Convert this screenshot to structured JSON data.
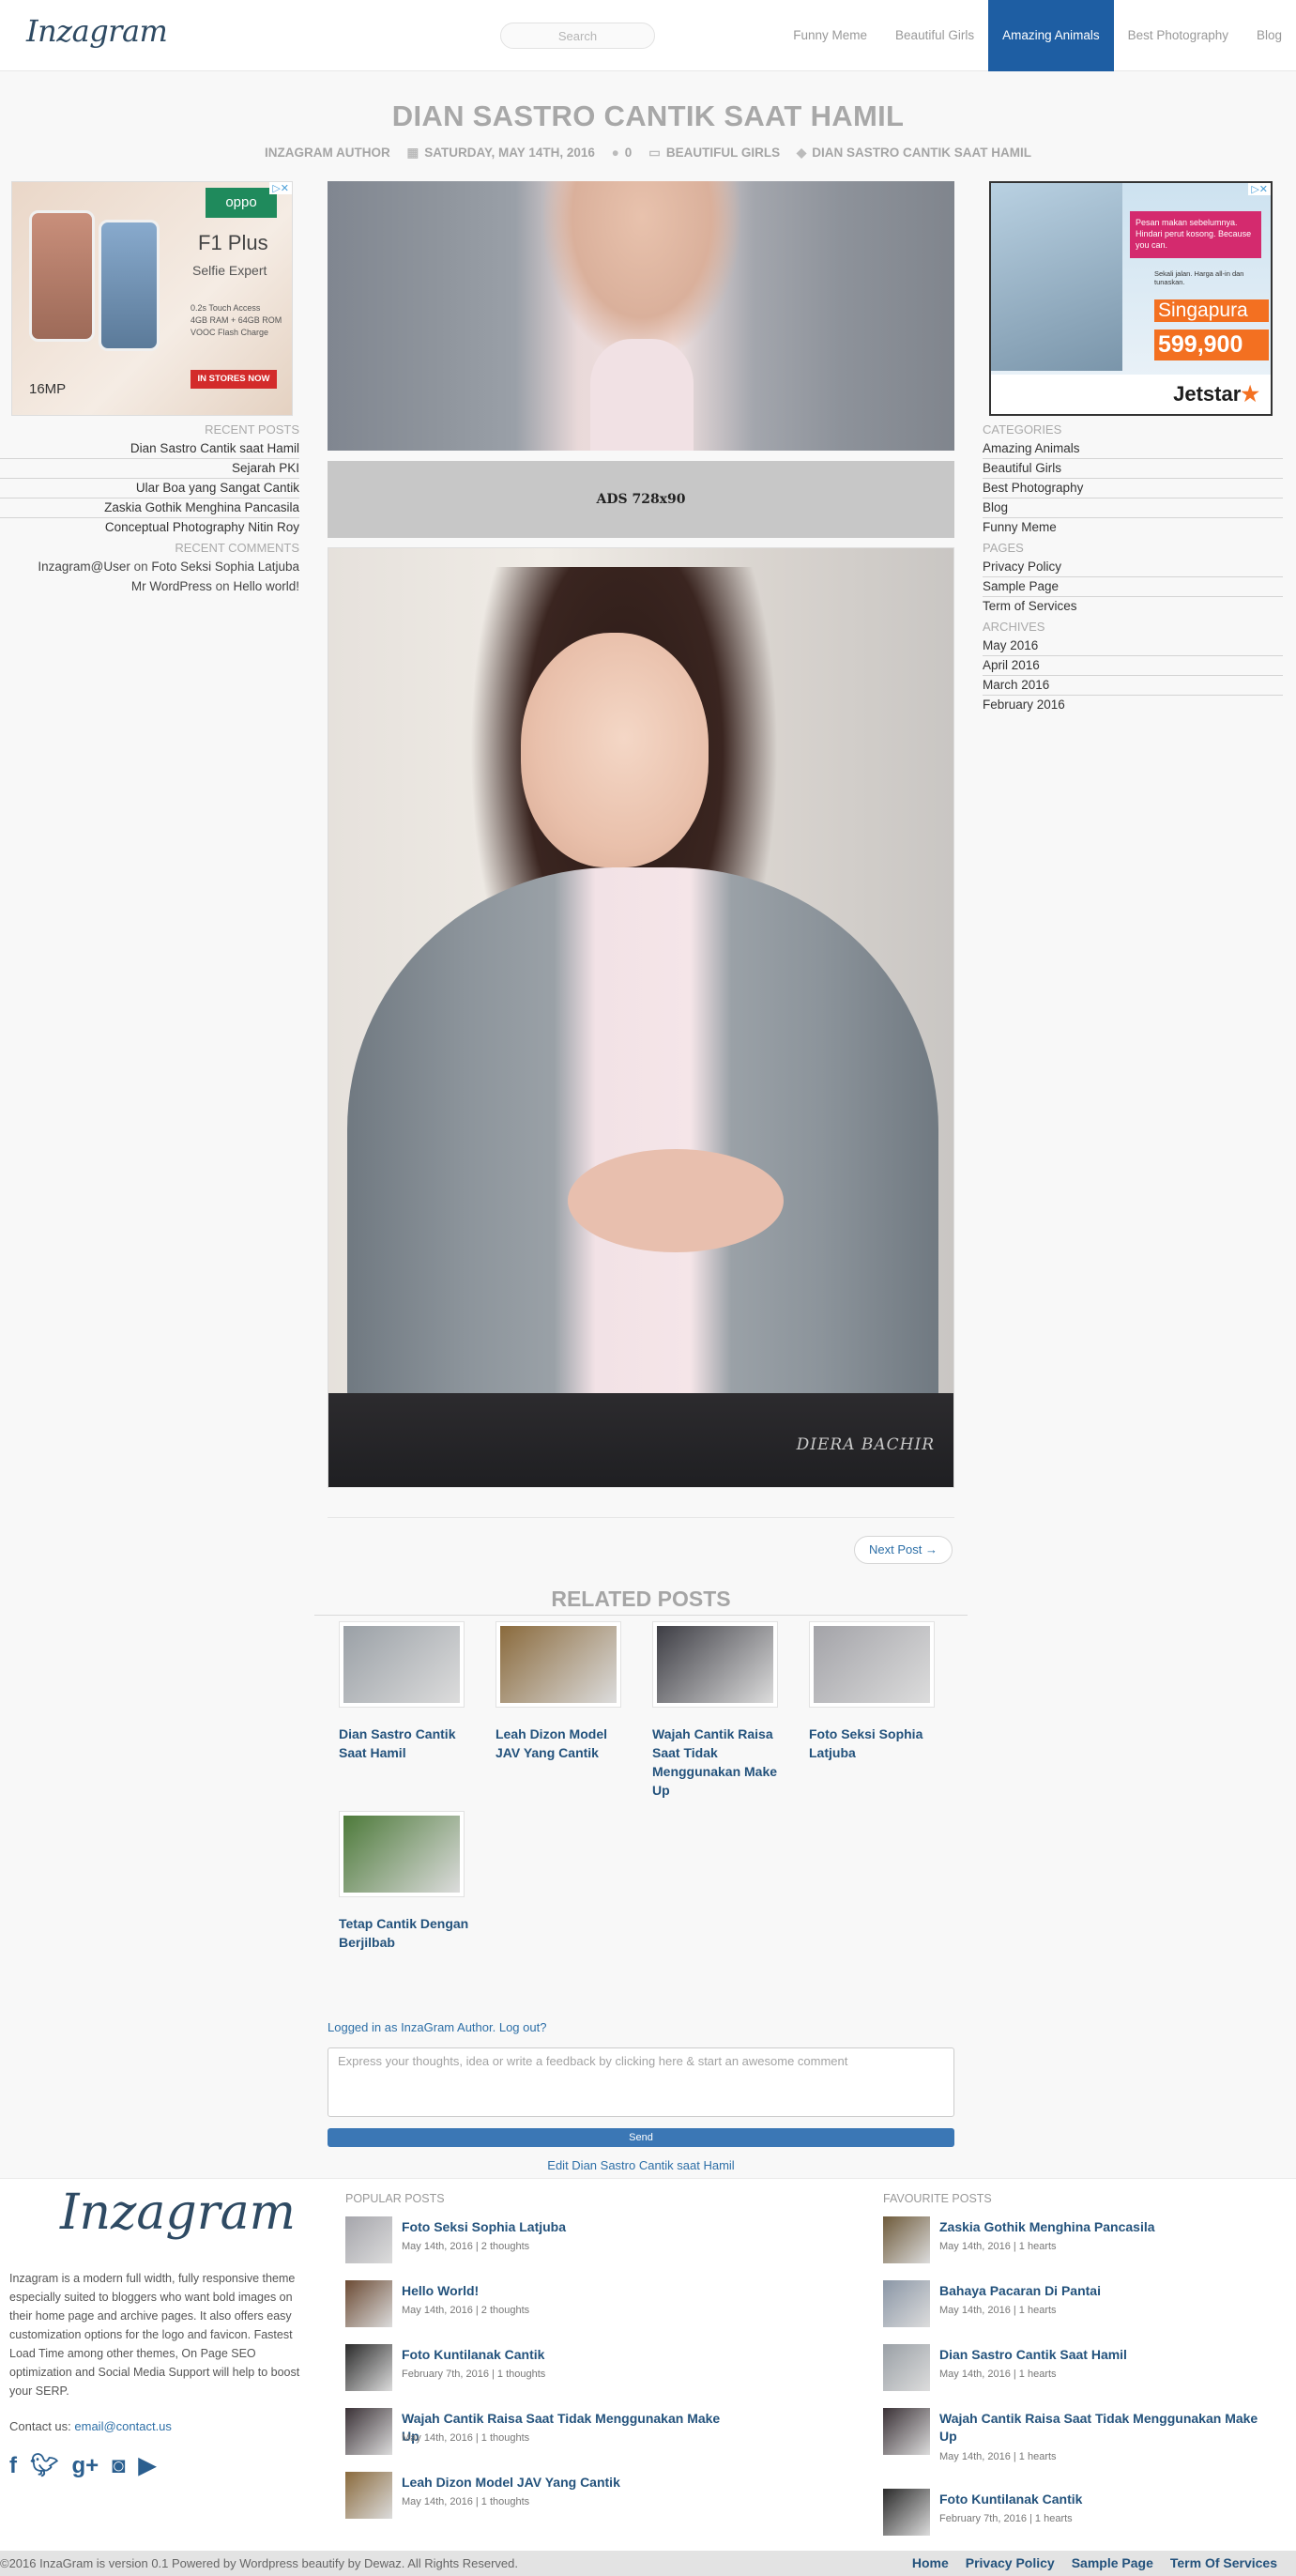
{
  "header": {
    "logo": "Inzagram",
    "search_placeholder": "Search",
    "nav": [
      "Funny Meme",
      "Beautiful Girls",
      "Amazing Animals",
      "Best Photography",
      "Blog"
    ],
    "active_nav": "Amazing Animals",
    "accent_color": "#1e5ea3"
  },
  "post": {
    "title": "DIAN SASTRO CANTIK SAAT HAMIL",
    "author": "INZAGRAM AUTHOR",
    "date": "SATURDAY, MAY 14TH, 2016",
    "comments": "0",
    "category": "BEAUTIFUL GIRLS",
    "tag": "DIAN SASTRO CANTIK SAAT HAMIL",
    "ads_label": "ADS 728x90",
    "watermark": "DIERA BACHIR",
    "next_post": "Next Post →"
  },
  "ad_left": {
    "brand": "oppo",
    "model": "F1 Plus",
    "tagline": "Selfie Expert",
    "specs": "0.2s Touch Access\n4GB RAM + 64GB ROM\nVOOC Flash Charge",
    "button": "IN STORES NOW",
    "camera": "16MP"
  },
  "ad_right": {
    "message": "Pesan makan sebelumnya. Hindari perut kosong. Because you can.",
    "sub": "Sekali jalan. Harga all-in dan tunaskan.",
    "city": "Singapura",
    "price": "599,900",
    "brand": "Jetstar"
  },
  "left_sidebar": {
    "recent_posts_title": "RECENT POSTS",
    "recent_posts": [
      "Dian Sastro Cantik saat Hamil",
      "Sejarah PKI",
      "Ular Boa yang Sangat Cantik",
      "Zaskia Gothik Menghina Pancasila",
      "Conceptual Photography Nitin Roy"
    ],
    "recent_comments_title": "RECENT COMMENTS",
    "recent_comments": [
      {
        "author": "Inzagram@User",
        "on": "on",
        "post": "Foto Seksi Sophia Latjuba"
      },
      {
        "author": "Mr WordPress",
        "on": "on",
        "post": "Hello world!"
      }
    ]
  },
  "right_sidebar": {
    "categories_title": "CATEGORIES",
    "categories": [
      "Amazing Animals",
      "Beautiful Girls",
      "Best Photography",
      "Blog",
      "Funny Meme"
    ],
    "pages_title": "PAGES",
    "pages": [
      "Privacy Policy",
      "Sample Page",
      "Term of Services"
    ],
    "archives_title": "ARCHIVES",
    "archives": [
      "May 2016",
      "April 2016",
      "March 2016",
      "February 2016"
    ]
  },
  "related": {
    "title": "RELATED POSTS",
    "items": [
      {
        "title": "Dian Sastro Cantik Saat Hamil",
        "color": "#9aa0a6"
      },
      {
        "title": "Leah Dizon Model JAV Yang Cantik",
        "color": "#8a6a3c"
      },
      {
        "title": "Wajah Cantik Raisa Saat Tidak Menggunakan Make Up",
        "color": "#3d3d44"
      },
      {
        "title": "Foto Seksi Sophia Latjuba",
        "color": "#a3a3a8"
      },
      {
        "title": "Tetap Cantik Dengan Berjilbab",
        "color": "#4d7a3a"
      }
    ]
  },
  "comment": {
    "logged_in": "Logged in as InzaGram Author. Log out?",
    "placeholder": "Express your thoughts, idea or write a feedback by clicking here & start an awesome comment",
    "send": "Send",
    "edit": "Edit Dian Sastro Cantik saat Hamil"
  },
  "footer": {
    "logo": "Inzagram",
    "about": "Inzagram is a modern full width, fully responsive theme especially suited to bloggers who want bold images on their home page and archive pages. It also offers easy customization options for the logo and favicon. Fastest Load Time among other themes, On Page SEO optimization and Social Media Support will help to boost your SERP.",
    "contact_label": "Contact us:",
    "contact_email": "email@contact.us",
    "social": [
      "f",
      "t",
      "g+",
      "ig",
      "yt"
    ],
    "popular_title": "POPULAR POSTS",
    "popular": [
      {
        "title": "Foto Seksi Sophia Latjuba",
        "date": "May 14th, 2016 | 2 thoughts",
        "color": "#a5a5ab"
      },
      {
        "title": "Hello World!",
        "date": "May 14th, 2016 | 2 thoughts",
        "color": "#6b4a33"
      },
      {
        "title": "Foto Kuntilanak Cantik",
        "date": "February 7th, 2016 | 1 thoughts",
        "color": "#2a2a2a"
      },
      {
        "title": "Wajah Cantik Raisa Saat Tidak Menggunakan Make Up",
        "date": "May 14th, 2016 | 1 thoughts",
        "color": "#3a3136"
      },
      {
        "title": "Leah Dizon Model JAV Yang Cantik",
        "date": "May 14th, 2016 | 1 thoughts",
        "color": "#8a6a3c"
      }
    ],
    "favourite_title": "FAVOURITE POSTS",
    "favourite": [
      {
        "title": "Zaskia Gothik Menghina Pancasila",
        "date": "May 14th, 2016 | 1 hearts",
        "color": "#6e5a3a"
      },
      {
        "title": "Bahaya Pacaran Di Pantai",
        "date": "May 14th, 2016 | 1 hearts",
        "color": "#8a96a6"
      },
      {
        "title": "Dian Sastro Cantik Saat Hamil",
        "date": "May 14th, 2016 | 1 hearts",
        "color": "#9aa0a6"
      },
      {
        "title": "Wajah Cantik Raisa Saat Tidak Menggunakan Make Up",
        "date": "May 14th, 2016 | 1 hearts",
        "color": "#3a3136"
      },
      {
        "title": "Foto Kuntilanak Cantik",
        "date": "February 7th, 2016 | 1 hearts",
        "color": "#2a2a2a"
      }
    ],
    "copyright": "©2016 InzaGram is version 0.1 Powered by Wordpress beautify by Dewaz. All Rights Reserved.",
    "bottom_links": [
      "Home",
      "Privacy Policy",
      "Sample Page",
      "Term Of Services"
    ]
  }
}
